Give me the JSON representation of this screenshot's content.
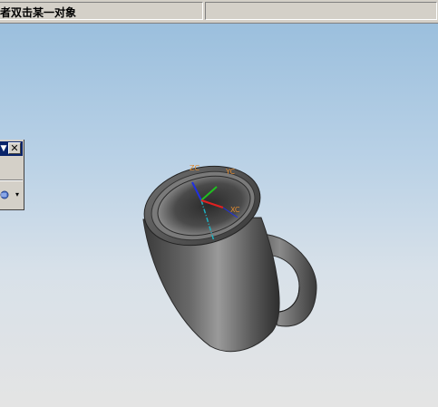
{
  "status_bar": {
    "prompt_text": "者双击某一对象",
    "secondary_text": ""
  },
  "toolbar": {
    "dropdown_icon": "chevron-down-icon",
    "close_icon": "close-icon",
    "close_glyph": "✕",
    "tool_icon": "render-style-icon",
    "arrow_glyph": "▾"
  },
  "viewport": {
    "background_top": "#9bbfdd",
    "background_bottom": "#e4e4e4",
    "model": "mug",
    "axis_labels": {
      "xc": "XC",
      "yc": "YC",
      "zc": "ZC"
    },
    "axis_colors": {
      "x": "#e02020",
      "y": "#20c020",
      "z": "#2030e0",
      "datum_axis": "#20b0c0"
    }
  }
}
